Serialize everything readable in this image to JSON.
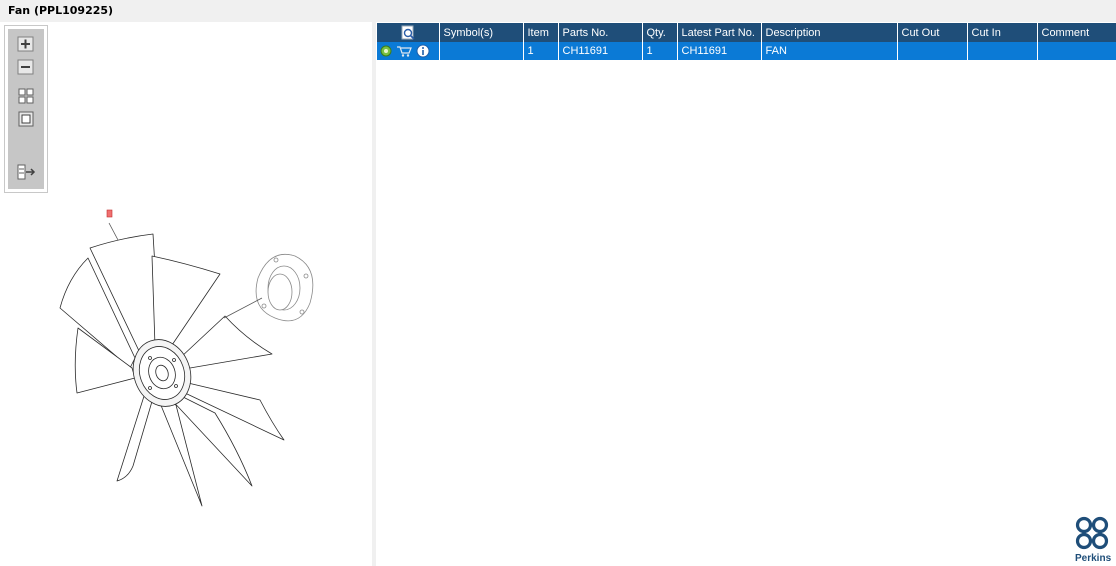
{
  "window": {
    "title": "Fan (PPL109225)"
  },
  "toolbar": {
    "buttons": [
      {
        "name": "zoom-in",
        "icon": "plus-icon"
      },
      {
        "name": "zoom-out",
        "icon": "minus-icon"
      },
      {
        "name": "fit-all",
        "icon": "grid-icon"
      },
      {
        "name": "fit-window",
        "icon": "square-icon"
      },
      {
        "name": "export",
        "icon": "list-arrow-icon"
      }
    ]
  },
  "table": {
    "columns": [
      "Symbol(s)",
      "Item",
      "Parts No.",
      "Qty.",
      "Latest Part No.",
      "Description",
      "Cut Out",
      "Cut In",
      "Comment"
    ],
    "rows": [
      {
        "symbols": "",
        "item": "1",
        "parts_no": "CH11691",
        "qty": "1",
        "latest_part_no": "CH11691",
        "description": "FAN",
        "cut_out": "",
        "cut_in": "",
        "comment": ""
      }
    ]
  },
  "brand": {
    "name": "Perkins",
    "color": "#1f4e79"
  },
  "colors": {
    "header_bg": "#1f4e79",
    "selected_row": "#0b7ad6",
    "callout": "#e05050"
  }
}
